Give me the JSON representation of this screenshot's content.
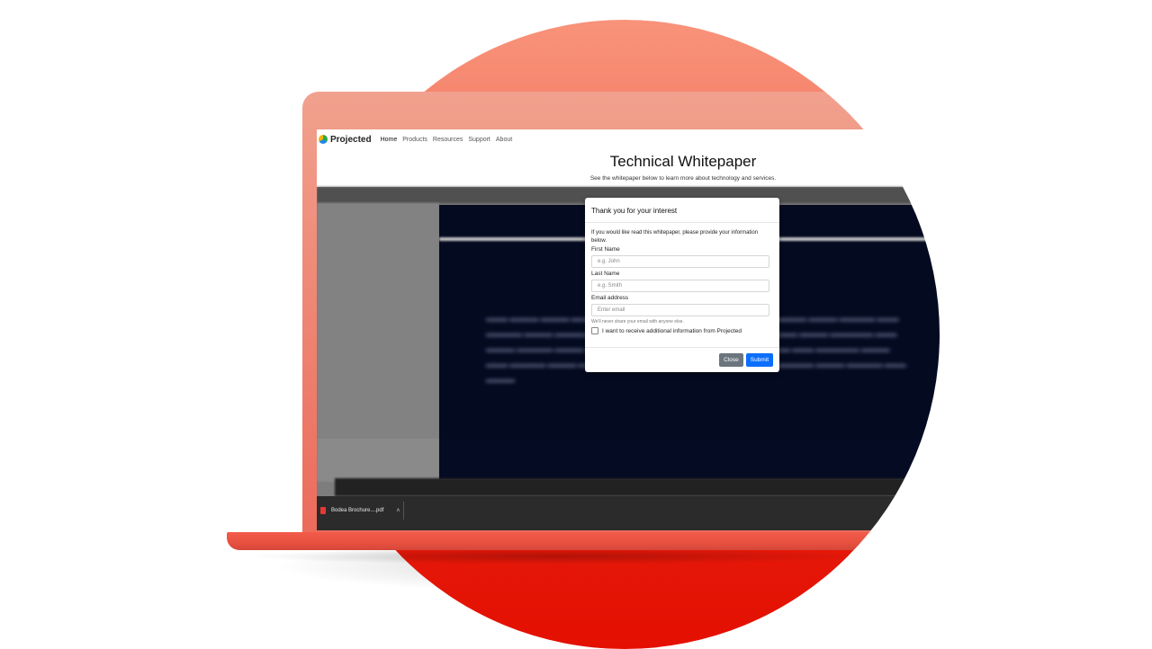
{
  "colors": {
    "circle_top": "#f8937a",
    "circle_bottom": "#e40f00",
    "laptop": "#ee8b78",
    "doc_background": "#050b22",
    "submit": "#0d6efd",
    "close": "#6c757d"
  },
  "nav": {
    "logo_icon": "projected-logo-icon",
    "logo": "Projected",
    "items": [
      "Home",
      "Products",
      "Resources",
      "Support",
      "About"
    ]
  },
  "page": {
    "title": "Technical Whitepaper",
    "subtitle": "See the whitepaper below to learn more about technology and services."
  },
  "modal": {
    "title": "Thank you for your interest",
    "intro": "If you would like read this whitepaper, please provide your information below.",
    "first_name_label": "First Name",
    "first_name_placeholder": "e.g. John",
    "last_name_label": "Last Name",
    "last_name_placeholder": "e.g. Smith",
    "email_label": "Email address",
    "email_placeholder": "Enter email",
    "email_help": "We'll never share your email with anyone else.",
    "checkbox_label": "I want to receive additional information from Projected",
    "close_button": "Close",
    "submit_button": "Submit"
  },
  "download_bar": {
    "file_icon": "pdf-file-icon",
    "file_name": "Bodea Brochure....pdf",
    "chevron_icon": "chevron-up-icon"
  }
}
